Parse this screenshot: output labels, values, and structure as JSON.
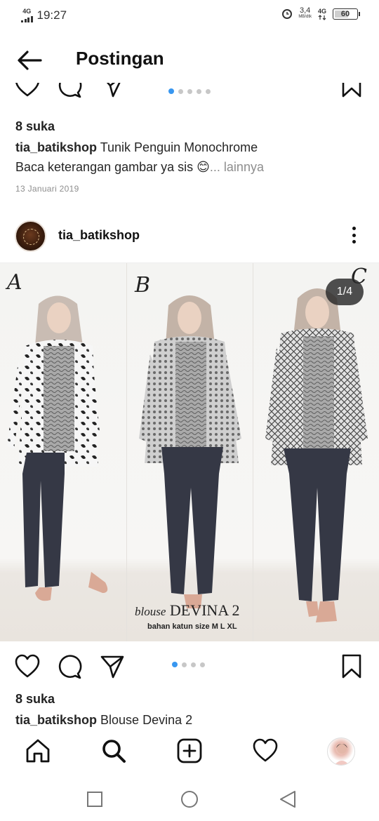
{
  "status_bar": {
    "network_left": "4G",
    "time": "19:27",
    "speed_value": "3,4",
    "speed_unit": "MB/dtk",
    "network_right": "4G",
    "battery": "60"
  },
  "header": {
    "title": "Postingan"
  },
  "previous_post": {
    "carousel_pages": 5,
    "carousel_active": 0,
    "likes": "8 suka",
    "username": "tia_batikshop",
    "caption": " Tunik Penguin Monochrome",
    "caption_line2": "Baca keterangan gambar ya sis 😊",
    "more": "... lainnya",
    "date": "13 Januari 2019"
  },
  "post": {
    "username": "tia_batikshop",
    "image": {
      "counter": "1/4",
      "variant_labels": [
        "A",
        "B",
        "C"
      ],
      "overlay_title_script": "blouse",
      "overlay_title_name": "DEVINA 2",
      "overlay_subtitle": "bahan katun size M L XL"
    },
    "carousel_pages": 4,
    "carousel_active": 0,
    "likes": "8 suka",
    "caption_username": "tia_batikshop",
    "caption": " Blouse Devina 2"
  },
  "icons": {
    "back": "arrow-left-icon",
    "like": "heart-icon",
    "comment": "comment-bubble-icon",
    "share": "send-paper-plane-icon",
    "save": "bookmark-icon",
    "more": "kebab-menu-icon",
    "home": "home-icon",
    "search": "search-icon",
    "add": "add-post-icon",
    "activity": "heart-icon",
    "sys_recent": "square-icon",
    "sys_home": "circle-icon",
    "sys_back": "triangle-back-icon"
  },
  "colors": {
    "accent_blue": "#3897f0",
    "text": "#262626",
    "muted": "#8e8e8e"
  }
}
